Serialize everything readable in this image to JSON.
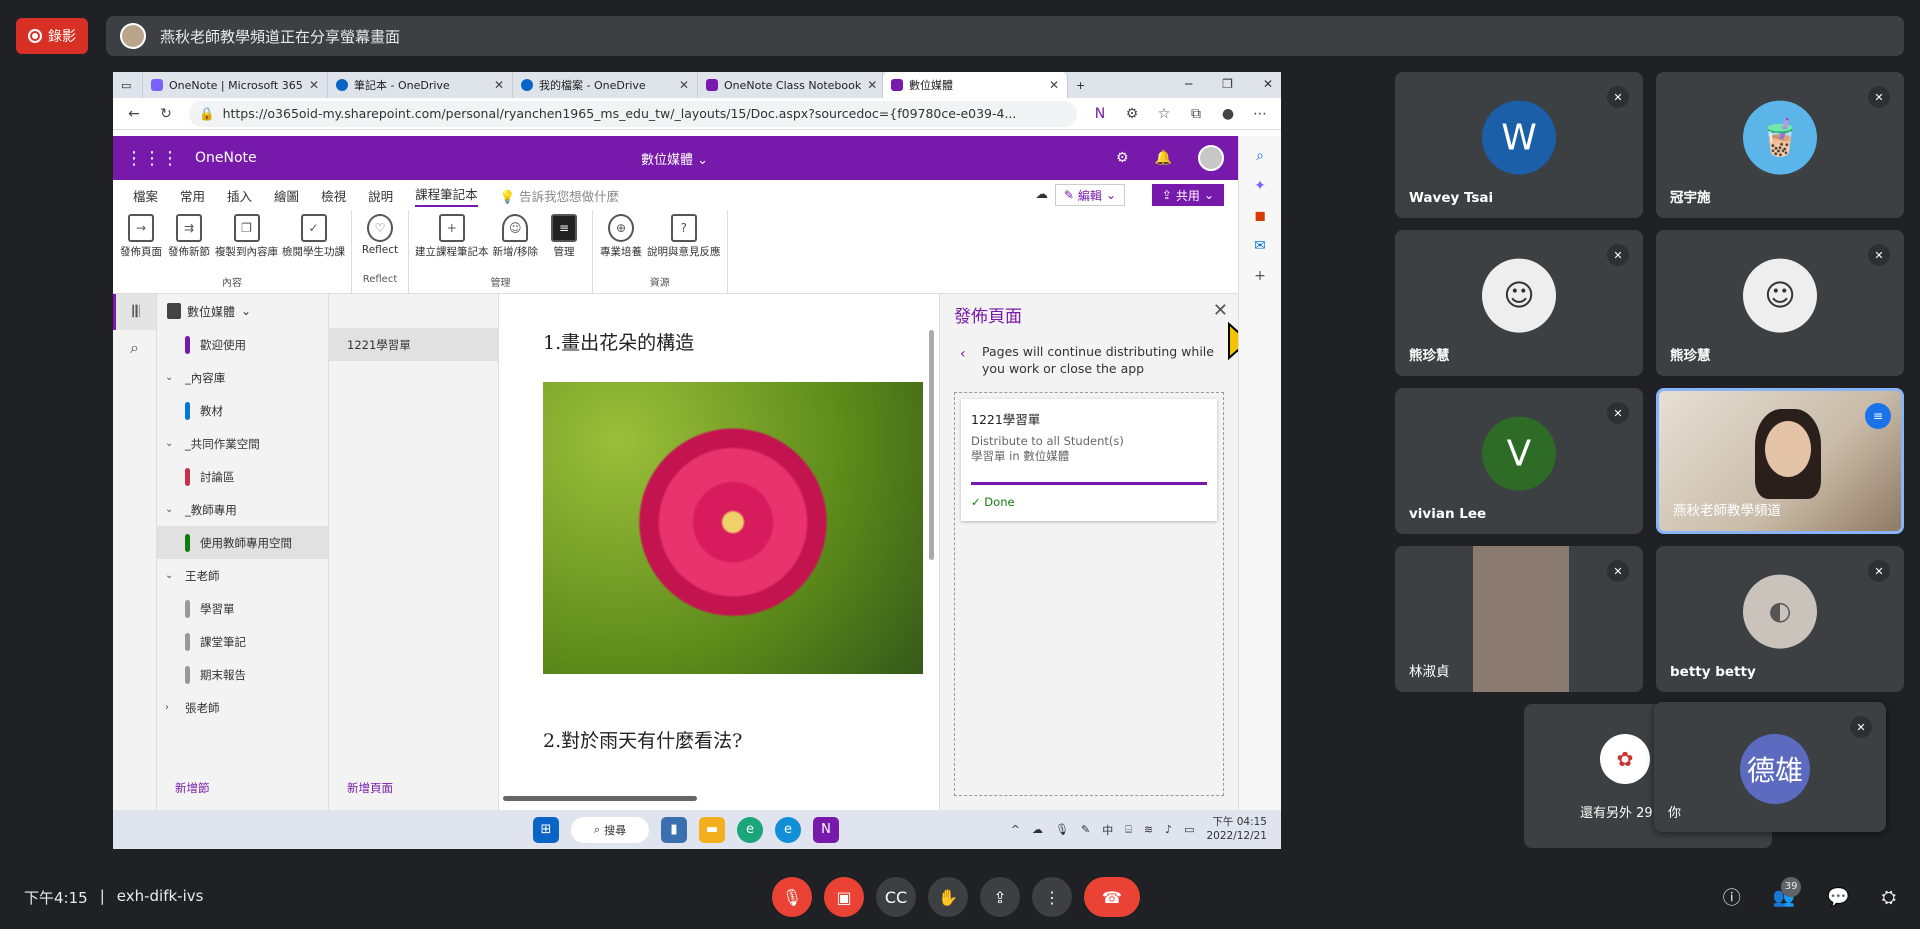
{
  "meet": {
    "rec_label": "錄影",
    "banner": "燕秋老師教學頻道正在分享螢幕畫面",
    "time": "下午4:15",
    "code": "exh-difk-ivs",
    "participant_count": "39",
    "colors": {
      "bg": "#202124",
      "tile": "#3c4043",
      "danger": "#ea4335",
      "active_border": "#8ab4f8"
    }
  },
  "browser": {
    "tabs": [
      {
        "label": "OneNote | Microsoft 365"
      },
      {
        "label": "筆記本 - OneDrive"
      },
      {
        "label": "我的檔案 - OneDrive"
      },
      {
        "label": "OneNote Class Notebook"
      },
      {
        "label": "數位媒體"
      }
    ],
    "url": "https://o365oid-my.sharepoint.com/personal/ryanchen1965_ms_edu_tw/_layouts/15/Doc.aspx?sourcedoc={f09780ce-e039-4..."
  },
  "onenote": {
    "app_name": "OneNote",
    "notebook_title": "數位媒體",
    "accent": "#7719aa",
    "menus": [
      "檔案",
      "常用",
      "插入",
      "繪圖",
      "檢視",
      "說明",
      "課程筆記本"
    ],
    "tell_me": "告訴我您想做什麼",
    "edit_label": "編輯",
    "share_label": "共用",
    "ribbon": {
      "groups": [
        {
          "label": "內容",
          "buttons": [
            "發佈頁面",
            "發佈新節",
            "複製到內容庫",
            "檢閱學生功課"
          ]
        },
        {
          "label": "Reflect",
          "buttons": [
            "Reflect"
          ]
        },
        {
          "label": "管理",
          "buttons": [
            "建立課程筆記本",
            "新增/移除",
            "管理"
          ]
        },
        {
          "label": "資源",
          "buttons": [
            "專業培養",
            "說明與意見反應"
          ]
        }
      ]
    },
    "notebook_name": "數位媒體",
    "sections": [
      {
        "label": "歡迎使用",
        "color": "#7719aa",
        "group": false
      },
      {
        "label": "_內容庫",
        "group": true
      },
      {
        "label": "教材",
        "color": "#0078d4",
        "group": false
      },
      {
        "label": "_共同作業空間",
        "group": true
      },
      {
        "label": "討論區",
        "color": "#c4314b",
        "group": false
      },
      {
        "label": "_教師專用",
        "group": true
      },
      {
        "label": "使用教師專用空間",
        "color": "#107c10",
        "group": false
      },
      {
        "label": "王老師",
        "group": true
      },
      {
        "label": "學習單",
        "color": "#999999",
        "group": false
      },
      {
        "label": "課堂筆記",
        "color": "#999999",
        "group": false
      },
      {
        "label": "期末報告",
        "color": "#999999",
        "group": false
      },
      {
        "label": "張老師",
        "group": true
      }
    ],
    "new_section": "新增節",
    "pages": [
      "1221學習單"
    ],
    "new_page": "新增頁面",
    "content": {
      "q1": "1.畫出花朵的構造",
      "q2": "2.對於雨天有什麼看法?"
    },
    "publish_pane": {
      "title": "發佈頁面",
      "message": "Pages will continue distributing while you work or close the app",
      "card_title": "1221學習單",
      "card_line1": "Distribute to all Student(s)",
      "card_line2": "學習單 in 數位媒體",
      "status": "Done"
    }
  },
  "taskbar": {
    "search": "搜尋",
    "tray_icons": [
      "中"
    ],
    "clock_time": "下午 04:15",
    "clock_date": "2022/12/21"
  },
  "participants": [
    {
      "name": "Wavey Tsai",
      "initial": "W",
      "color": "#1a5fa8"
    },
    {
      "name": "冠宇施",
      "initial": "",
      "color": "#5bb5e8"
    },
    {
      "name": "熊珍慧",
      "initial": "",
      "color": "#eeeeee"
    },
    {
      "name": "熊珍慧",
      "initial": "",
      "color": "#eeeeee"
    },
    {
      "name": "vivian Lee",
      "initial": "V",
      "color": "#2e6b27"
    },
    {
      "name": "燕秋老師教學頻道",
      "initial": "",
      "color": "#d9cdbd"
    },
    {
      "name": "林淑貞",
      "initial": "",
      "color": "#8a7a70"
    },
    {
      "name": "betty betty",
      "initial": "",
      "color": "#c9c3bb"
    },
    {
      "name": "還有另外 29",
      "initial": "",
      "color": "#c33"
    },
    {
      "name": "你",
      "initial": "德雄",
      "color": "#5c6bc0"
    }
  ]
}
